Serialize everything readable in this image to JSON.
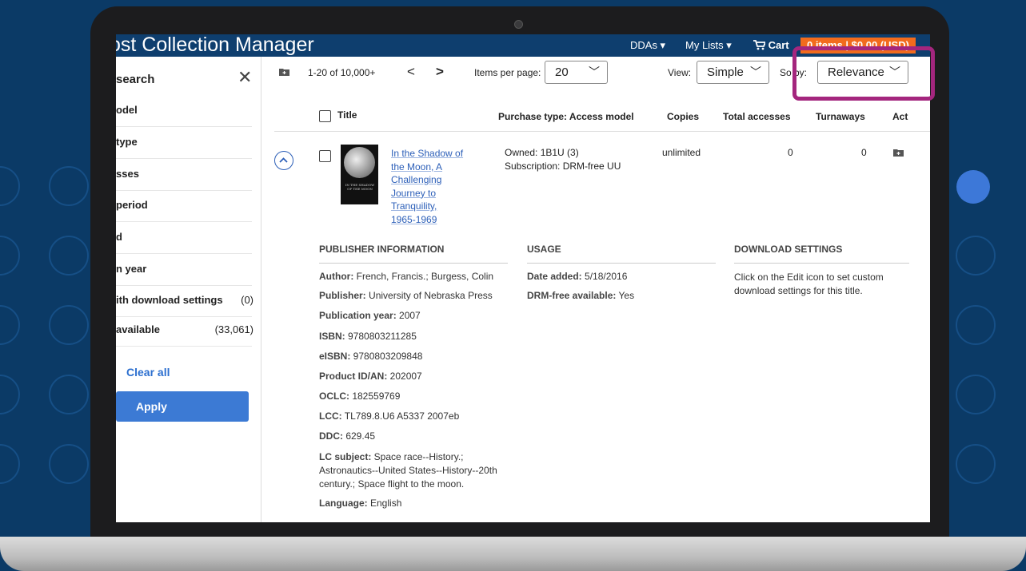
{
  "app": {
    "title": "ost Collection Manager",
    "nav": {
      "ddas": "DDAs ▾",
      "my_lists": "My Lists ▾",
      "cart": "Cart",
      "cart_badge": "0 items | $0.00 (USD)"
    }
  },
  "sidebar": {
    "heading": "search",
    "close": "✕",
    "filters": [
      {
        "label": "odel",
        "count": ""
      },
      {
        "label": "type",
        "count": ""
      },
      {
        "label": "sses",
        "count": ""
      },
      {
        "label": "period",
        "count": ""
      },
      {
        "label": "d",
        "count": ""
      },
      {
        "label": "n year",
        "count": ""
      },
      {
        "label": "ith download settings",
        "count": "(0)"
      },
      {
        "label": "available",
        "count": "(33,061)"
      }
    ],
    "clear_all": "Clear all",
    "apply": "Apply"
  },
  "toolbar": {
    "range": "1-20 of 10,000+",
    "prev": "<",
    "next": ">",
    "items_per_page_label": "Items per page:",
    "items_per_page_value": "20",
    "view_label": "View:",
    "view_value": "Simple",
    "sort_label": "So     by:",
    "sort_value": "Relevance"
  },
  "table": {
    "headers": {
      "title": "Title",
      "purchase_type": "Purchase type: Access model",
      "copies": "Copies",
      "total_accesses": "Total accesses",
      "turnaways": "Turnaways",
      "actions": "Act"
    },
    "row": {
      "title_lines": [
        "In the Shadow of",
        "the Moon, A",
        "Challenging",
        "Journey to",
        "Tranquility,",
        "1965-1969"
      ],
      "cover_text": "IN THE SHADOW OF THE MOON",
      "owned": "Owned: 1B1U (3)",
      "subscription": "Subscription: DRM-free UU",
      "copies": "unlimited",
      "total_accesses": "0",
      "turnaways": "0"
    }
  },
  "details": {
    "publisher_heading": "PUBLISHER INFORMATION",
    "usage_heading": "USAGE",
    "download_heading": "DOWNLOAD SETTINGS",
    "publisher": [
      {
        "k": "Author:",
        "v": " French, Francis.; Burgess, Colin"
      },
      {
        "k": "Publisher:",
        "v": " University of Nebraska Press"
      },
      {
        "k": "Publication year:",
        "v": " 2007"
      },
      {
        "k": "ISBN:",
        "v": " 9780803211285"
      },
      {
        "k": "eISBN:",
        "v": " 9780803209848"
      },
      {
        "k": "Product ID/AN:",
        "v": " 202007"
      },
      {
        "k": "OCLC:",
        "v": " 182559769"
      },
      {
        "k": "LCC:",
        "v": " TL789.8.U6 A5337 2007eb"
      },
      {
        "k": "DDC:",
        "v": " 629.45"
      }
    ],
    "lc_subject_key": "LC subject:",
    "lc_subject_lines": [
      " Space race--History.;",
      "Astronautics--United States--History--20th",
      "century.; Space flight to the moon."
    ],
    "language_key": "Language:",
    "language_value": " English",
    "usage": [
      {
        "k": "Date added:",
        "v": " 5/18/2016"
      },
      {
        "k": "DRM-free available:",
        "v": " Yes"
      }
    ],
    "download_text_lines": [
      "Click on the Edit icon to set custom",
      "download settings for this title."
    ]
  },
  "colors": {
    "brand": "#0e3e6e",
    "accent": "#3c7ad4",
    "highlight": "#a4267e",
    "cart": "#f26b1d"
  }
}
